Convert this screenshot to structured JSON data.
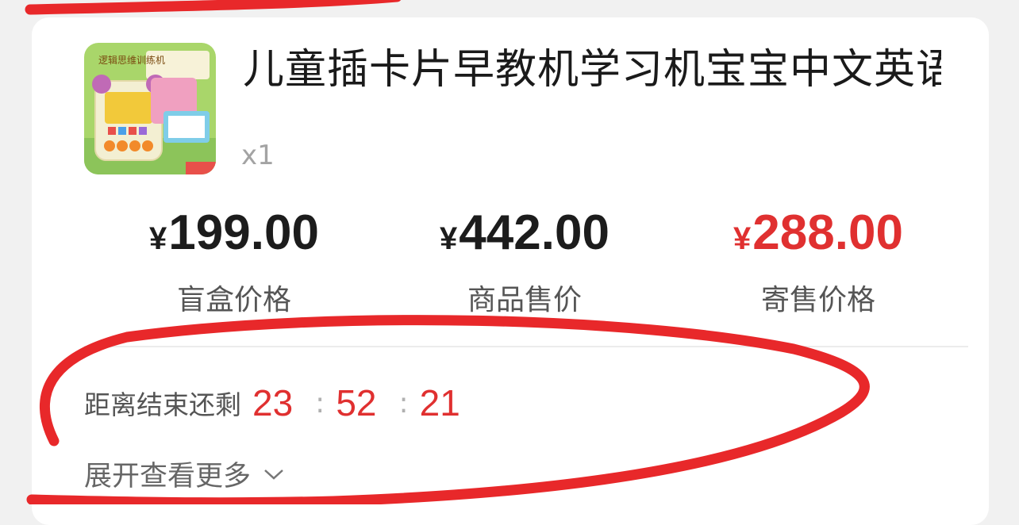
{
  "product": {
    "title": "儿童插卡片早教机学习机宝宝中文英语双语汉字卡片",
    "quantity": "x1",
    "thumbnail_icon": "product-image",
    "thumbnail_text": "逻辑思维训练机"
  },
  "prices": [
    {
      "currency": "¥",
      "amount": "199.00",
      "label": "盲盒价格",
      "color": "#1c1c1c"
    },
    {
      "currency": "¥",
      "amount": "442.00",
      "label": "商品售价",
      "color": "#1c1c1c"
    },
    {
      "currency": "¥",
      "amount": "288.00",
      "label": "寄售价格",
      "color": "#e03030"
    }
  ],
  "countdown": {
    "label": "距离结束还剩",
    "hours": "23",
    "minutes": "52",
    "seconds": "21",
    "separator": ":"
  },
  "expand": {
    "label": "展开查看更多",
    "icon": "chevron-down-icon"
  },
  "colors": {
    "accent": "#e03030",
    "annotation": "#e8282a"
  }
}
